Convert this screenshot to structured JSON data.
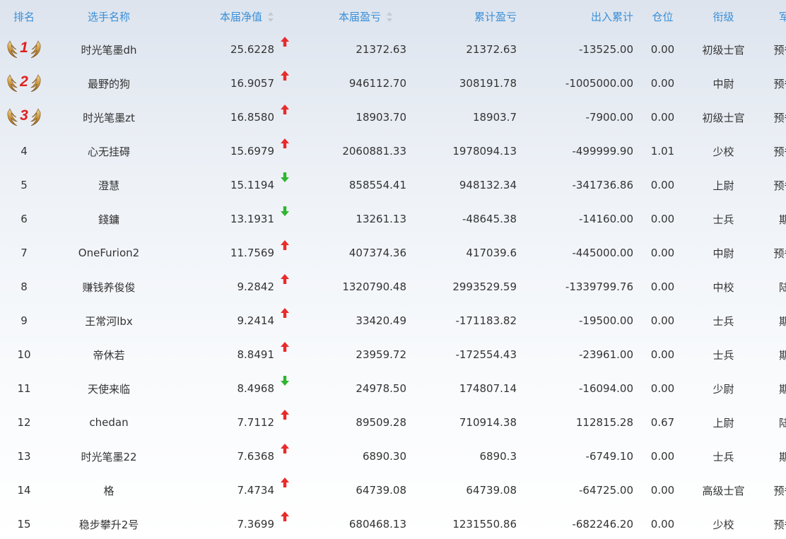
{
  "headers": {
    "rank": "排名",
    "name": "选手名称",
    "nav": "本届净值",
    "pnl": "本届盈亏",
    "cumulative": "累计盈亏",
    "flow": "出入累计",
    "position": "仓位",
    "title": "衔级",
    "branch": "军种"
  },
  "colors": {
    "header_text": "#3a8fd8",
    "up_arrow": "#e82b2b",
    "down_arrow": "#2fb52f",
    "medal_number": "#e01f1f"
  },
  "rows": [
    {
      "rank": "1",
      "medal": true,
      "name": "时光笔墨dh",
      "nav": "25.6228",
      "trend": "up",
      "pnl": "21372.63",
      "cumulative": "21372.63",
      "flow": "-13525.00",
      "position": "0.00",
      "title": "初级士官",
      "branch": "预备役"
    },
    {
      "rank": "2",
      "medal": true,
      "name": "最野的狗",
      "nav": "16.9057",
      "trend": "up",
      "pnl": "946112.70",
      "cumulative": "308191.78",
      "flow": "-1005000.00",
      "position": "0.00",
      "title": "中尉",
      "branch": "预备役"
    },
    {
      "rank": "3",
      "medal": true,
      "name": "时光笔墨zt",
      "nav": "16.8580",
      "trend": "up",
      "pnl": "18903.70",
      "cumulative": "18903.7",
      "flow": "-7900.00",
      "position": "0.00",
      "title": "初级士官",
      "branch": "预备役"
    },
    {
      "rank": "4",
      "medal": false,
      "name": "心无挂碍",
      "nav": "15.6979",
      "trend": "up",
      "pnl": "2060881.33",
      "cumulative": "1978094.13",
      "flow": "-499999.90",
      "position": "1.01",
      "title": "少校",
      "branch": "预备役"
    },
    {
      "rank": "5",
      "medal": false,
      "name": "澄慧",
      "nav": "15.1194",
      "trend": "down",
      "pnl": "858554.41",
      "cumulative": "948132.34",
      "flow": "-341736.86",
      "position": "0.00",
      "title": "上尉",
      "branch": "预备役"
    },
    {
      "rank": "6",
      "medal": false,
      "name": "錢鏞",
      "nav": "13.1931",
      "trend": "down",
      "pnl": "13261.13",
      "cumulative": "-48645.38",
      "flow": "-14160.00",
      "position": "0.00",
      "title": "士兵",
      "branch": "期权"
    },
    {
      "rank": "7",
      "medal": false,
      "name": "OneFurion2",
      "nav": "11.7569",
      "trend": "up",
      "pnl": "407374.36",
      "cumulative": "417039.6",
      "flow": "-445000.00",
      "position": "0.00",
      "title": "中尉",
      "branch": "预备役"
    },
    {
      "rank": "8",
      "medal": false,
      "name": "赚钱养俊俊",
      "nav": "9.2842",
      "trend": "up",
      "pnl": "1320790.48",
      "cumulative": "2993529.59",
      "flow": "-1339799.76",
      "position": "0.00",
      "title": "中校",
      "branch": "陆军"
    },
    {
      "rank": "9",
      "medal": false,
      "name": "王常河lbx",
      "nav": "9.2414",
      "trend": "up",
      "pnl": "33420.49",
      "cumulative": "-171183.82",
      "flow": "-19500.00",
      "position": "0.00",
      "title": "士兵",
      "branch": "期权"
    },
    {
      "rank": "10",
      "medal": false,
      "name": "帝休若",
      "nav": "8.8491",
      "trend": "up",
      "pnl": "23959.72",
      "cumulative": "-172554.43",
      "flow": "-23961.00",
      "position": "0.00",
      "title": "士兵",
      "branch": "期权"
    },
    {
      "rank": "11",
      "medal": false,
      "name": "天使来临",
      "nav": "8.4968",
      "trend": "down",
      "pnl": "24978.50",
      "cumulative": "174807.14",
      "flow": "-16094.00",
      "position": "0.00",
      "title": "少尉",
      "branch": "期权"
    },
    {
      "rank": "12",
      "medal": false,
      "name": "chedan",
      "nav": "7.7112",
      "trend": "up",
      "pnl": "89509.28",
      "cumulative": "710914.38",
      "flow": "112815.28",
      "position": "0.67",
      "title": "上尉",
      "branch": "陆军"
    },
    {
      "rank": "13",
      "medal": false,
      "name": "时光笔墨22",
      "nav": "7.6368",
      "trend": "up",
      "pnl": "6890.30",
      "cumulative": "6890.3",
      "flow": "-6749.10",
      "position": "0.00",
      "title": "士兵",
      "branch": "期权"
    },
    {
      "rank": "14",
      "medal": false,
      "name": "格",
      "nav": "7.4734",
      "trend": "up",
      "pnl": "64739.08",
      "cumulative": "64739.08",
      "flow": "-64725.00",
      "position": "0.00",
      "title": "高级士官",
      "branch": "预备役"
    },
    {
      "rank": "15",
      "medal": false,
      "name": "稳步攀升2号",
      "nav": "7.3699",
      "trend": "up",
      "pnl": "680468.13",
      "cumulative": "1231550.86",
      "flow": "-682246.20",
      "position": "0.00",
      "title": "少校",
      "branch": "预备役"
    }
  ]
}
